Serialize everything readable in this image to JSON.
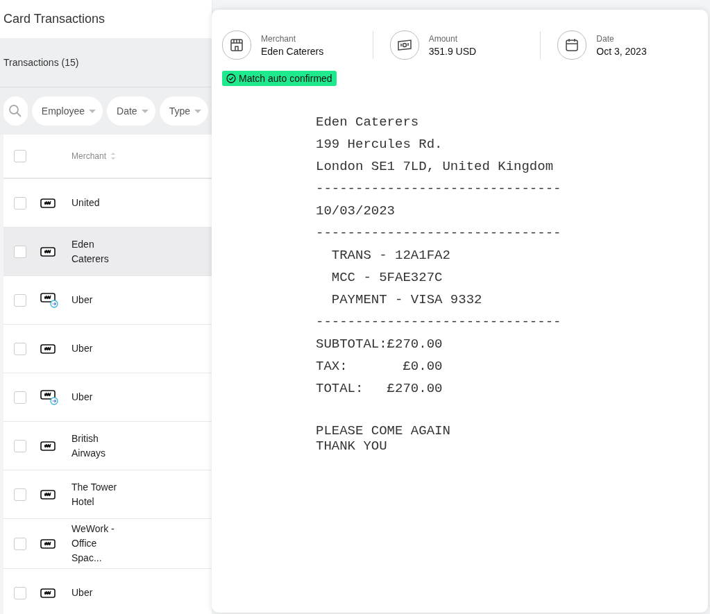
{
  "page": {
    "title": "Card Transactions",
    "section_title": "Transactions (15)"
  },
  "filters": [
    {
      "label": "Employee"
    },
    {
      "label": "Date"
    },
    {
      "label": "Type"
    }
  ],
  "table": {
    "select_all_checked": false,
    "columns": [
      {
        "label": "Merchant"
      }
    ],
    "rows": [
      {
        "merchant": "United",
        "linked": false,
        "selected": false,
        "checked": false
      },
      {
        "merchant": "Eden Caterers",
        "linked": false,
        "selected": true,
        "checked": false
      },
      {
        "merchant": "Uber",
        "linked": true,
        "selected": false,
        "checked": false
      },
      {
        "merchant": "Uber",
        "linked": false,
        "selected": false,
        "checked": false
      },
      {
        "merchant": "Uber",
        "linked": true,
        "selected": false,
        "checked": false
      },
      {
        "merchant": "British Airways",
        "linked": false,
        "selected": false,
        "checked": false
      },
      {
        "merchant": "The Tower Hotel",
        "linked": false,
        "selected": false,
        "checked": false
      },
      {
        "merchant": "WeWork - Office Spac...",
        "linked": false,
        "selected": false,
        "checked": false
      },
      {
        "merchant": "Uber",
        "linked": false,
        "selected": false,
        "checked": false
      }
    ]
  },
  "detail": {
    "fields": [
      {
        "kind": "merchant",
        "label": "Merchant",
        "value": "Eden Caterers"
      },
      {
        "kind": "amount",
        "label": "Amount",
        "value": "351.9 USD"
      },
      {
        "kind": "date",
        "label": "Date",
        "value": "Oct 3, 2023"
      }
    ],
    "match_status": "Match auto confirmed",
    "receipt": {
      "lines": [
        "Eden Caterers",
        "199 Hercules Rd.",
        "London SE1 7LD, United Kingdom",
        "-------------------------------",
        "10/03/2023",
        "-------------------------------",
        "  TRANS - 12A1FA2",
        "  MCC - 5FAE327C",
        "  PAYMENT - VISA 9332",
        "-------------------------------",
        "SUBTOTAL:£270.00",
        "TAX:       £0.00",
        "TOTAL:   £270.00"
      ],
      "footer_lines": [
        "PLEASE COME AGAIN",
        "THANK YOU"
      ]
    }
  }
}
